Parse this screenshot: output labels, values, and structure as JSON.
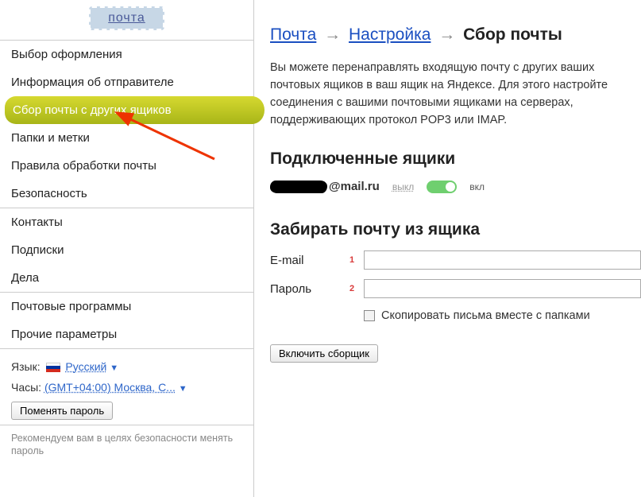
{
  "sidebar": {
    "mail_tab": "почта",
    "groups": [
      [
        "Выбор оформления",
        "Информация об отправителе",
        "Сбор почты с других ящиков",
        "Папки и метки",
        "Правила обработки почты",
        "Безопасность"
      ],
      [
        "Контакты",
        "Подписки",
        "Дела"
      ],
      [
        "Почтовые программы",
        "Прочие параметры"
      ]
    ],
    "active": "Сбор почты с других ящиков",
    "lang_label": "Язык:",
    "lang_value": "Русский",
    "clock_label": "Часы:",
    "clock_value": "(GMT+04:00) Москва, С...",
    "change_pw": "Поменять пароль",
    "hint": "Рекомендуем вам в целях безопасности менять пароль"
  },
  "breadcrumb": {
    "mail": "Почта",
    "settings": "Настройка",
    "current": "Сбор почты"
  },
  "description": "Вы можете перенаправлять входящую почту с других ваших почтовых ящиков в ваш ящик на Яндексе. Для этого настройте соединения с вашими почтовыми ящиками на серверах, поддерживающих протокол POP3 или IMAP.",
  "connected": {
    "title": "Подключенные ящики",
    "address_suffix": "@mail.ru",
    "off": "выкл",
    "on": "вкл"
  },
  "fetch": {
    "title": "Забирать почту из ящика",
    "email_label": "E-mail",
    "password_label": "Пароль",
    "badge1": "1",
    "badge2": "2",
    "copy_label": "Скопировать письма вместе с папками",
    "submit": "Включить сборщик"
  }
}
